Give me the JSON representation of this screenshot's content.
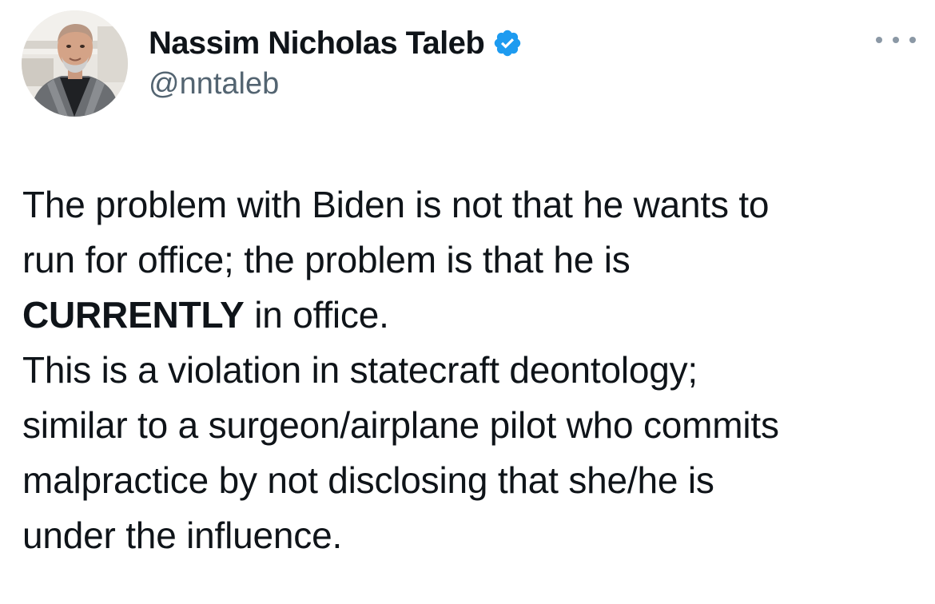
{
  "author": {
    "display_name": "Nassim Nicholas Taleb",
    "handle": "@nntaleb",
    "verified": true,
    "verified_icon": "verified-badge-icon",
    "verified_color": "#1d9bf0"
  },
  "menu": {
    "icon": "more-options-icon"
  },
  "tweet": {
    "line1": "The problem with Biden is not that he wants to",
    "line2": "run for office; the problem is that he is",
    "line3_bold": "CURRENTLY",
    "line3_rest": " in office.",
    "line4": "This is a violation in statecraft deontology;",
    "line5": "similar to a surgeon/airplane pilot who commits",
    "line6": "malpractice by not disclosing that she/he is",
    "line7": "under the influence."
  },
  "colors": {
    "text": "#0f1419",
    "secondary": "#536471",
    "accent": "#1d9bf0"
  }
}
